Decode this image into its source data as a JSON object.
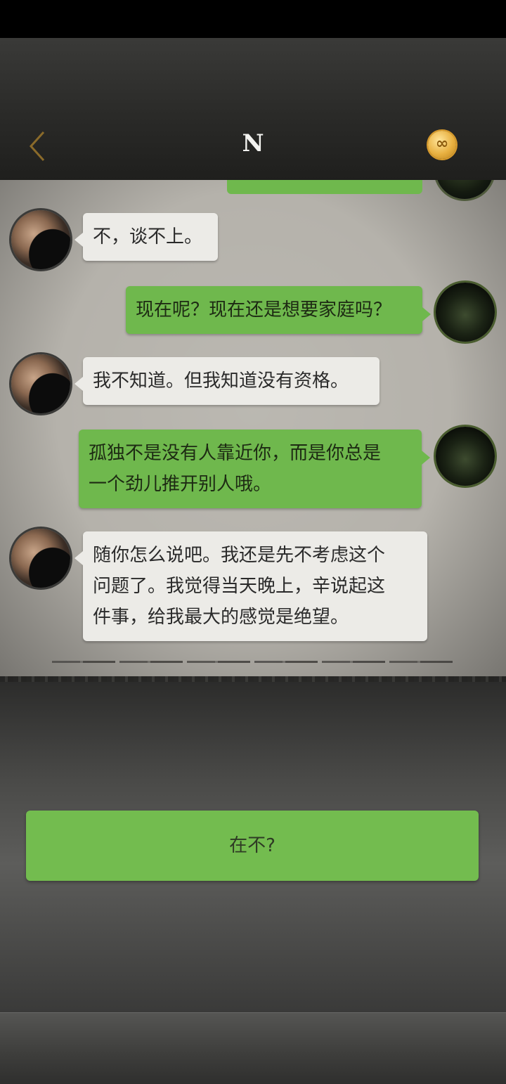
{
  "header": {
    "title": "N",
    "back_icon": "chevron-left-icon",
    "coin_icon": "infinity-coin-icon",
    "coin_symbol": "∞"
  },
  "messages": [
    {
      "side": "left",
      "text": "不，谈不上。"
    },
    {
      "side": "right",
      "text": "现在呢？现在还是想要家庭吗？"
    },
    {
      "side": "left",
      "text": "我不知道。但我知道没有资格。"
    },
    {
      "side": "right",
      "line1": "孤独不是没有人靠近你，而是你总是",
      "line2": "一个劲儿推开别人哦。"
    },
    {
      "side": "left",
      "line1": "随你怎么说吧。我还是先不考虑这个",
      "line2": "问题了。我觉得当天晚上，辛说起这",
      "line3": "件事，给我最大的感觉是绝望。"
    }
  ],
  "choice": {
    "label": "在不?"
  },
  "colors": {
    "accent_green": "#6fb84d",
    "npc_bubble": "#ecebe7",
    "back_gold": "#8a6a2a"
  }
}
